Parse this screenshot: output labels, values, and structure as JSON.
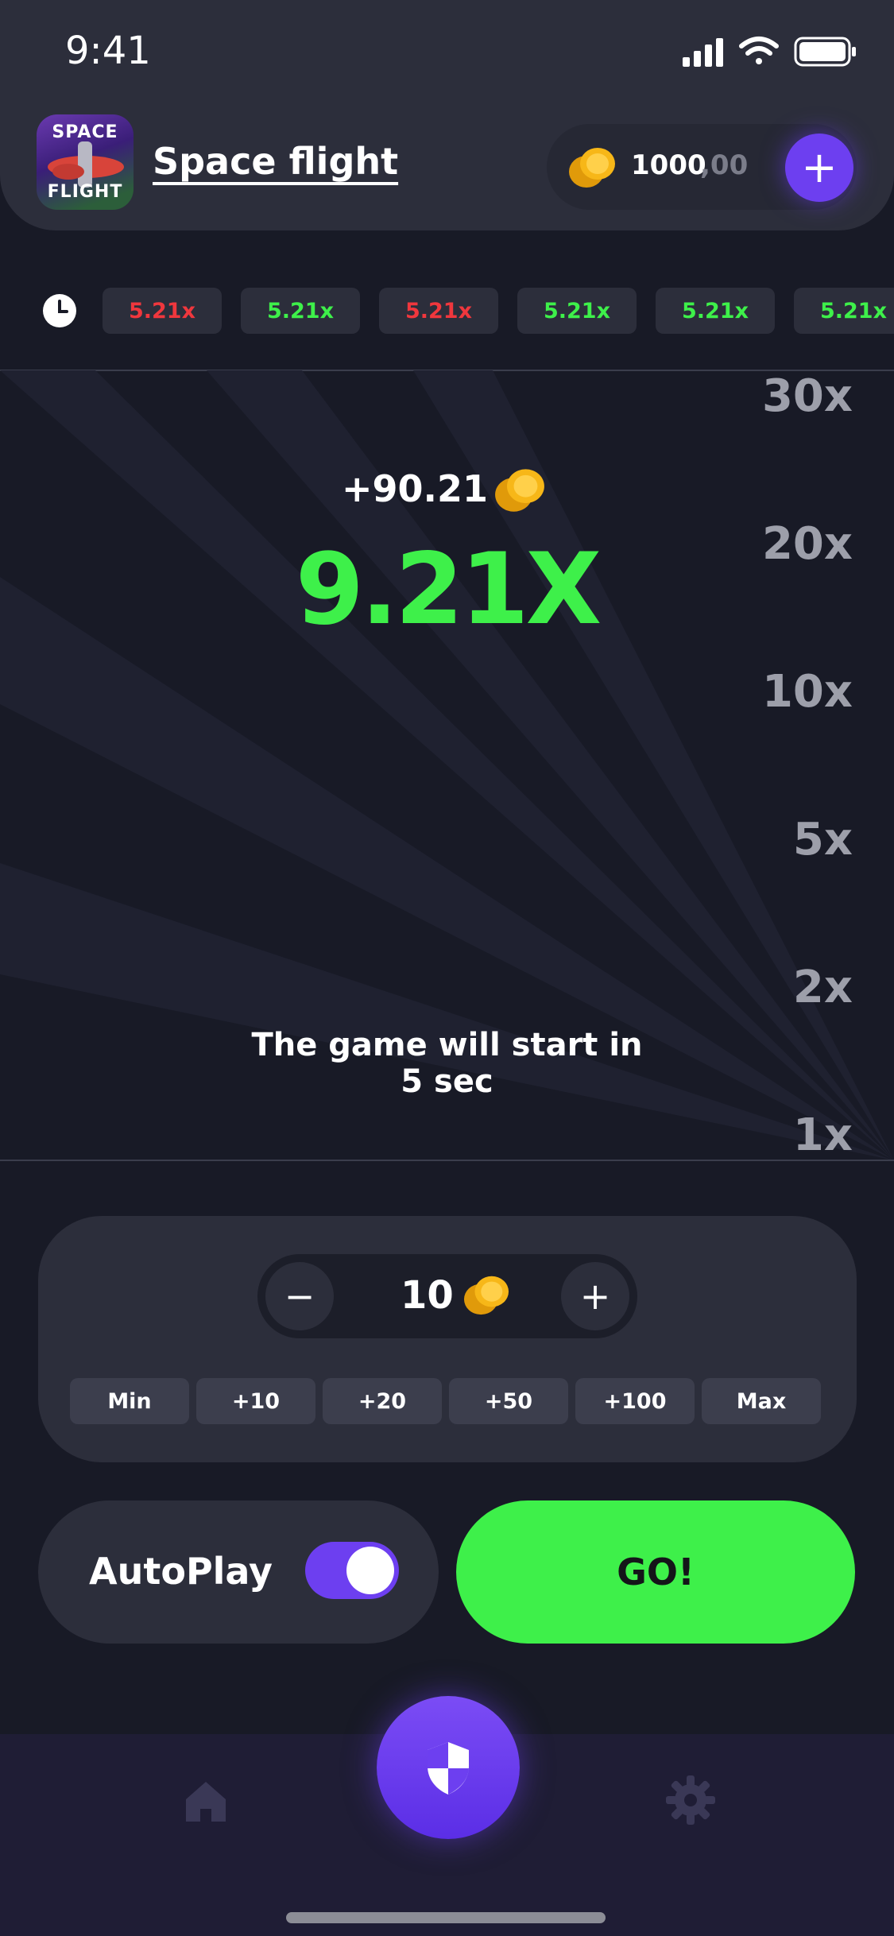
{
  "status_bar": {
    "time": "9:41"
  },
  "header": {
    "logo_line1": "SPACE",
    "logo_line2": "FLIGHT",
    "title": "Space flight",
    "balance_int": "1000",
    "balance_dec": ",00",
    "add_label": "+"
  },
  "history": {
    "icon": "clock-icon",
    "items": [
      {
        "label": "5.21x",
        "status": "red"
      },
      {
        "label": "5.21x",
        "status": "green"
      },
      {
        "label": "5.21x",
        "status": "red"
      },
      {
        "label": "5.21x",
        "status": "green"
      },
      {
        "label": "5.21x",
        "status": "green"
      },
      {
        "label": "5.21x",
        "status": "green"
      }
    ]
  },
  "game": {
    "scale": [
      "30x",
      "20x",
      "10x",
      "5x",
      "2x",
      "1x"
    ],
    "win_amount": "+90.21",
    "multiplier": "9.21X",
    "countdown_line1": "The game will start in",
    "countdown_line2": "5 sec"
  },
  "bet": {
    "minus_label": "−",
    "plus_label": "+",
    "value": "10",
    "quick": [
      "Min",
      "+10",
      "+20",
      "+50",
      "+100",
      "Max"
    ]
  },
  "controls": {
    "autoplay_label": "AutoPlay",
    "autoplay_on": true,
    "go_label": "GO!"
  },
  "nav": {
    "left": "home-icon",
    "center": "shield-icon",
    "right": "gear-icon"
  },
  "colors": {
    "background": "#181a26",
    "card": "#2c2e3b",
    "accent_purple": "#6d3ff0",
    "green": "#3ef04a",
    "red": "#f0373d"
  }
}
